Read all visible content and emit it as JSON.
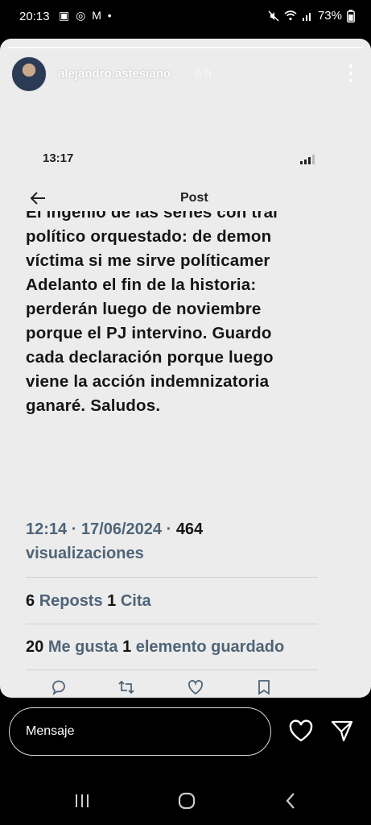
{
  "status_bar": {
    "time": "20:13",
    "left_icons": "▣ ◎ M •",
    "battery": "73%"
  },
  "story": {
    "username": "alejandro.astesiano",
    "time_ago": "6 h"
  },
  "screenshot": {
    "time": "13:17",
    "header_title": "Post",
    "tweet_lines": [
      "El ingenio de las series con trai",
      "político orquestado: de demon",
      "víctima si me sirve políticamer",
      "Adelanto el fin de la historia:",
      "perderán luego de noviembre",
      "porque el PJ intervino.  Guardo",
      "cada declaración porque luego",
      "viene la acción indemnizatoria",
      "ganaré. Saludos."
    ],
    "timestamp": "12:14 · 17/06/2024 ·",
    "views_count": "464",
    "views_label": "visualizaciones",
    "reposts_count": "6",
    "reposts_label": "Reposts",
    "quotes_count": "1",
    "quotes_label": "Cita",
    "likes_count": "20",
    "likes_label": "Me gusta",
    "bookmarks_count": "1",
    "bookmarks_label": "elemento guardado"
  },
  "reply_bar": {
    "placeholder": "Mensaje"
  },
  "colors": {
    "story_bg": "#ececec",
    "meta_gray": "#4f6478",
    "text_dark": "#151515"
  }
}
